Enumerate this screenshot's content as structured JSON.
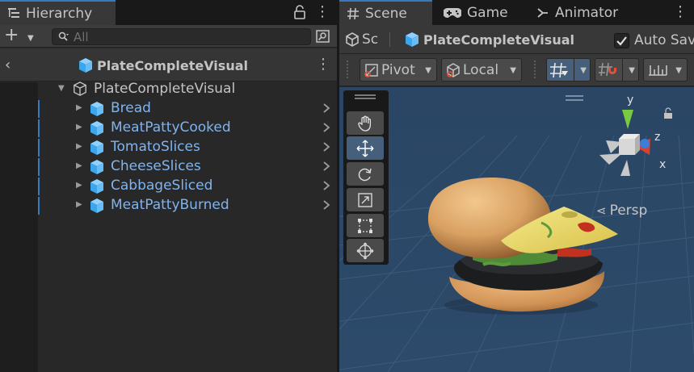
{
  "hierarchy": {
    "tab_label": "Hierarchy",
    "search_placeholder": "All",
    "header_title": "PlateCompleteVisual",
    "root": {
      "label": "PlateCompleteVisual"
    },
    "children": [
      {
        "label": "Bread"
      },
      {
        "label": "MeatPattyCooked"
      },
      {
        "label": "TomatoSlices"
      },
      {
        "label": "CheeseSlices"
      },
      {
        "label": "CabbageSliced"
      },
      {
        "label": "MeatPattyBurned"
      }
    ]
  },
  "scene": {
    "tabs": [
      {
        "label": "Scene",
        "icon": "hash-icon"
      },
      {
        "label": "Game",
        "icon": "gamepad-icon"
      },
      {
        "label": "Animator",
        "icon": "animator-icon"
      }
    ],
    "breadcrumb_scene": "Sc",
    "breadcrumb_prefab": "PlateCompleteVisual",
    "autosave_label": "Auto Sav",
    "autosave_checked": true,
    "pivot_label": "Pivot",
    "local_label": "Local",
    "persp_label": "Persp",
    "gizmo_axes": {
      "y": "y",
      "z": "z",
      "x": "x"
    }
  },
  "colors": {
    "accent": "#3a79bb",
    "child_text": "#7fb4ef",
    "panel_bg": "#282828",
    "toolbar_bg": "#383838",
    "active_tool": "#46607c"
  }
}
